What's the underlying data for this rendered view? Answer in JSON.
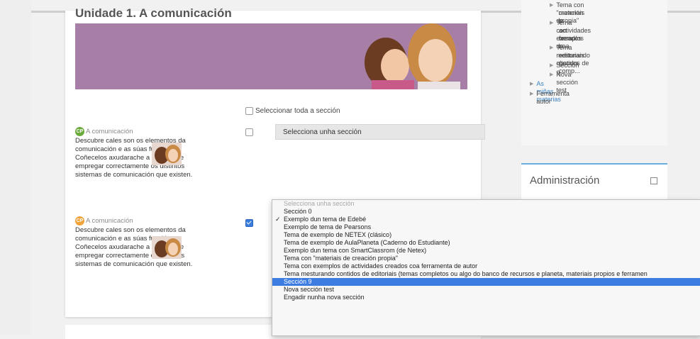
{
  "card": {
    "title": "Unidade 1. A comunicación",
    "select_all_label": "Seleccionar toda a sección",
    "activities": [
      {
        "icon_label": "CP",
        "title": "A comunicación",
        "text": "Descubre cales son os elementos da comunicación e as súas funcións. Coñecelos axudarache a entender e empregar correctamente os distintos sistemas de comunicación que existen.",
        "checked": false
      },
      {
        "icon_label": "CP",
        "title": "A comunicación",
        "text": "Descubre cales son os elementos da comunicación e as súas funcións. Coñecelos axudarache a entender e empregar correctamente os distintos sistemas de comunicación que existen.",
        "checked": true
      }
    ],
    "section_select_value": "Selecciona unha sección"
  },
  "sidebar_tree": [
    {
      "text": "Tema con \"materiais de"
    },
    {
      "text": "creación propia\""
    },
    {
      "text": "Tema con exemplos de"
    },
    {
      "text": "actividades creados coa"
    },
    {
      "text": "ferra..."
    },
    {
      "text": "Tema mesturando contidos de"
    },
    {
      "text": "editoriais (temas comp..."
    },
    {
      "text": "Sección 9"
    },
    {
      "text": "Nova sección test"
    },
    {
      "text": "As miñas materias"
    },
    {
      "text": "Ferramenta autor"
    }
  ],
  "admin_block": {
    "title": "Administración"
  },
  "dropdown": {
    "options": [
      {
        "label": "Selecciona unha sección",
        "placeholder": true
      },
      {
        "label": "Sección 0"
      },
      {
        "label": "Exemplo dun tema de Edebé",
        "checked": true
      },
      {
        "label": "Exemplo de tema de Pearsons"
      },
      {
        "label": "Tema de exemplo de NETEX (clásico)"
      },
      {
        "label": "Tema de exemplo de AulaPlaneta (Caderno do Estudiante)"
      },
      {
        "label": "Exemplo dun tema con SmartClassrom (de Netex)"
      },
      {
        "label": "Tema con \"materiais de creación propia\""
      },
      {
        "label": "Tema con exemplos de actividades creados coa ferramenta de autor"
      },
      {
        "label": "Tema mesturando contidos de editoriais (temas completos ou algo do banco de recursos e planeta, materiais propios e ferramen"
      },
      {
        "label": "Sección 9",
        "highlight": true
      },
      {
        "label": "Nova sección test"
      },
      {
        "label": "Engadir nunha nova sección"
      }
    ],
    "check_glyph": "✓"
  },
  "colors": {
    "banner": "#a77ea6",
    "highlight": "#3d7ce0",
    "link": "#3b83c4",
    "admin_border": "#6aaee0"
  }
}
